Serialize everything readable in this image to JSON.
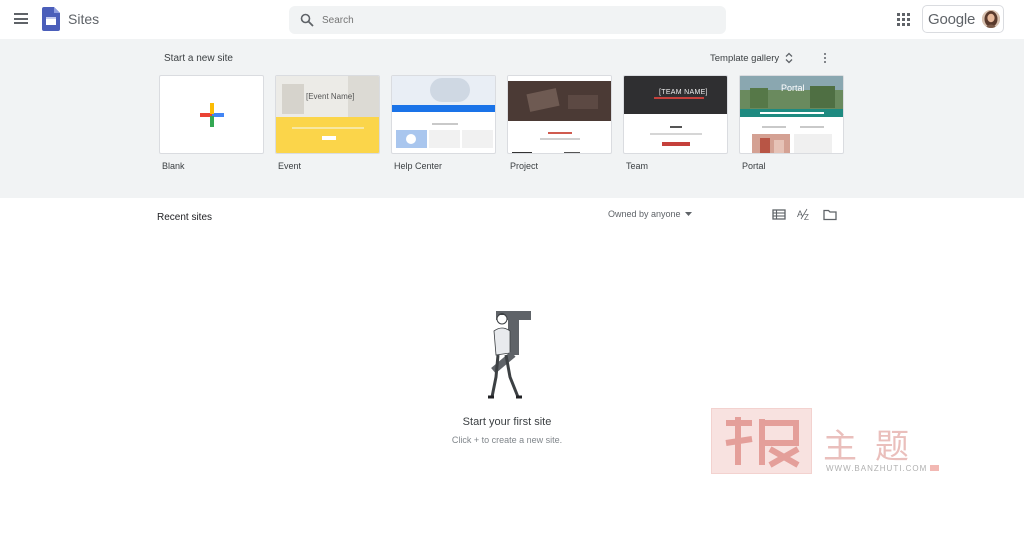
{
  "header": {
    "app_name": "Sites",
    "search_placeholder": "Search",
    "account_brand": "Google"
  },
  "templates": {
    "section_title": "Start a new site",
    "gallery_label": "Template gallery",
    "items": [
      {
        "label": "Blank",
        "thumb_text": ""
      },
      {
        "label": "Event",
        "thumb_text": "[Event Name]"
      },
      {
        "label": "Help Center",
        "thumb_text": ""
      },
      {
        "label": "Project",
        "thumb_text": ""
      },
      {
        "label": "Team",
        "thumb_text": "[TEAM NAME]"
      },
      {
        "label": "Portal",
        "thumb_text": "Portal"
      }
    ]
  },
  "recent": {
    "section_title": "Recent sites",
    "owner_filter": "Owned by anyone",
    "empty_title": "Start your first site",
    "empty_subtitle": "Click + to create a new site."
  },
  "watermark": {
    "chars": "主题",
    "url": "WWW.BANZHUTI.COM"
  },
  "colors": {
    "sites_blue": "#4b5eba",
    "band_bg": "#f1f3f4",
    "event_yellow": "#fbd54a",
    "help_blue": "#1a73e8",
    "team_red": "#c5403b",
    "portal_teal": "#1e8a80"
  }
}
